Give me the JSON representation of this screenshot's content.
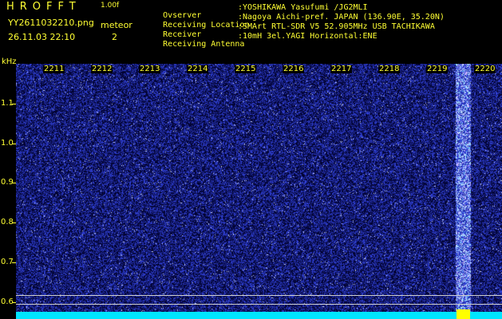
{
  "header": {
    "logo": "HROFFT",
    "version": "1.00f",
    "filename": "YY2611032210.png",
    "timestamp": "26.11.03 22:10",
    "meteor_label": "meteor",
    "meteor_count": "2",
    "info": [
      {
        "key": "Ovserver",
        "value": ":YOSHIKAWA Yasufumi /JG2MLI"
      },
      {
        "key": "Receiving Location",
        "value": ":Nagoya Aichi-pref. JAPAN (136.90E, 35.20N)"
      },
      {
        "key": "Receiver",
        "value": ":SMArt RTL-SDR V5 52.905MHz USB TACHIKAWA"
      },
      {
        "key": "Receiving Antenna",
        "value": ":10mH 3el.YAGI Horizontal:ENE"
      }
    ]
  },
  "axis": {
    "y_unit": "kHz",
    "y_ticks": [
      "1.1",
      "1.0",
      "0.9",
      "0.8",
      "0.7",
      "0.6"
    ],
    "x_ticks": [
      "2211",
      "2212",
      "2213",
      "2214",
      "2215",
      "2216",
      "2217",
      "2218",
      "2219",
      "2220"
    ]
  },
  "colors": {
    "text": "#ffff33",
    "background": "#000000",
    "noise_dark": "#00003a",
    "noise_bright": "#3c46ff",
    "baseline": "#00e5ff",
    "marker": "#ffff00"
  }
}
